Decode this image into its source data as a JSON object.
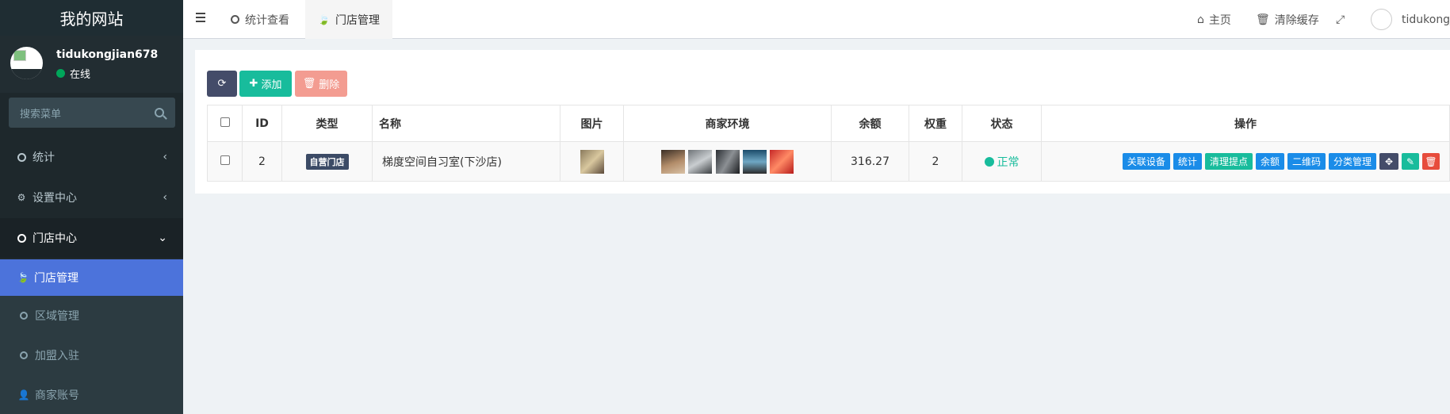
{
  "sidebar": {
    "logo": "我的网站",
    "user": {
      "name": "tidukongjian678",
      "status": "在线"
    },
    "search_placeholder": "搜索菜单",
    "items": [
      {
        "label": "统计",
        "icon": "circle-icon"
      },
      {
        "label": "设置中心",
        "icon": "cogs-icon"
      },
      {
        "label": "门店中心",
        "icon": "circle-icon"
      },
      {
        "label": "门店管理",
        "icon": "leaf-icon"
      },
      {
        "label": "区域管理",
        "icon": "circle-icon"
      },
      {
        "label": "加盟入驻",
        "icon": "circle-icon"
      },
      {
        "label": "商家账号",
        "icon": "user-icon"
      }
    ]
  },
  "header": {
    "tabs": [
      {
        "label": "统计查看"
      },
      {
        "label": "门店管理"
      }
    ],
    "home": "主页",
    "clear_cache": "清除缓存",
    "user": "tidukongjia"
  },
  "toolbar": {
    "add": "添加",
    "delete": "删除"
  },
  "table": {
    "columns": [
      "ID",
      "类型",
      "名称",
      "图片",
      "商家环境",
      "余额",
      "权重",
      "状态",
      "操作"
    ],
    "rows": [
      {
        "id": "2",
        "type": "自营门店",
        "name": "梯度空间自习室(下沙店)",
        "balance": "316.27",
        "weight": "2",
        "status": "正常"
      }
    ],
    "actions": [
      "关联设备",
      "统计",
      "清理提点",
      "余额",
      "二维码",
      "分类管理"
    ]
  },
  "colors": {
    "sidebar_bg": "#1e282c",
    "active_menu": "#4c73db",
    "success": "#18bc9c",
    "primary": "#1a8ce8",
    "danger": "#e74c3c"
  }
}
